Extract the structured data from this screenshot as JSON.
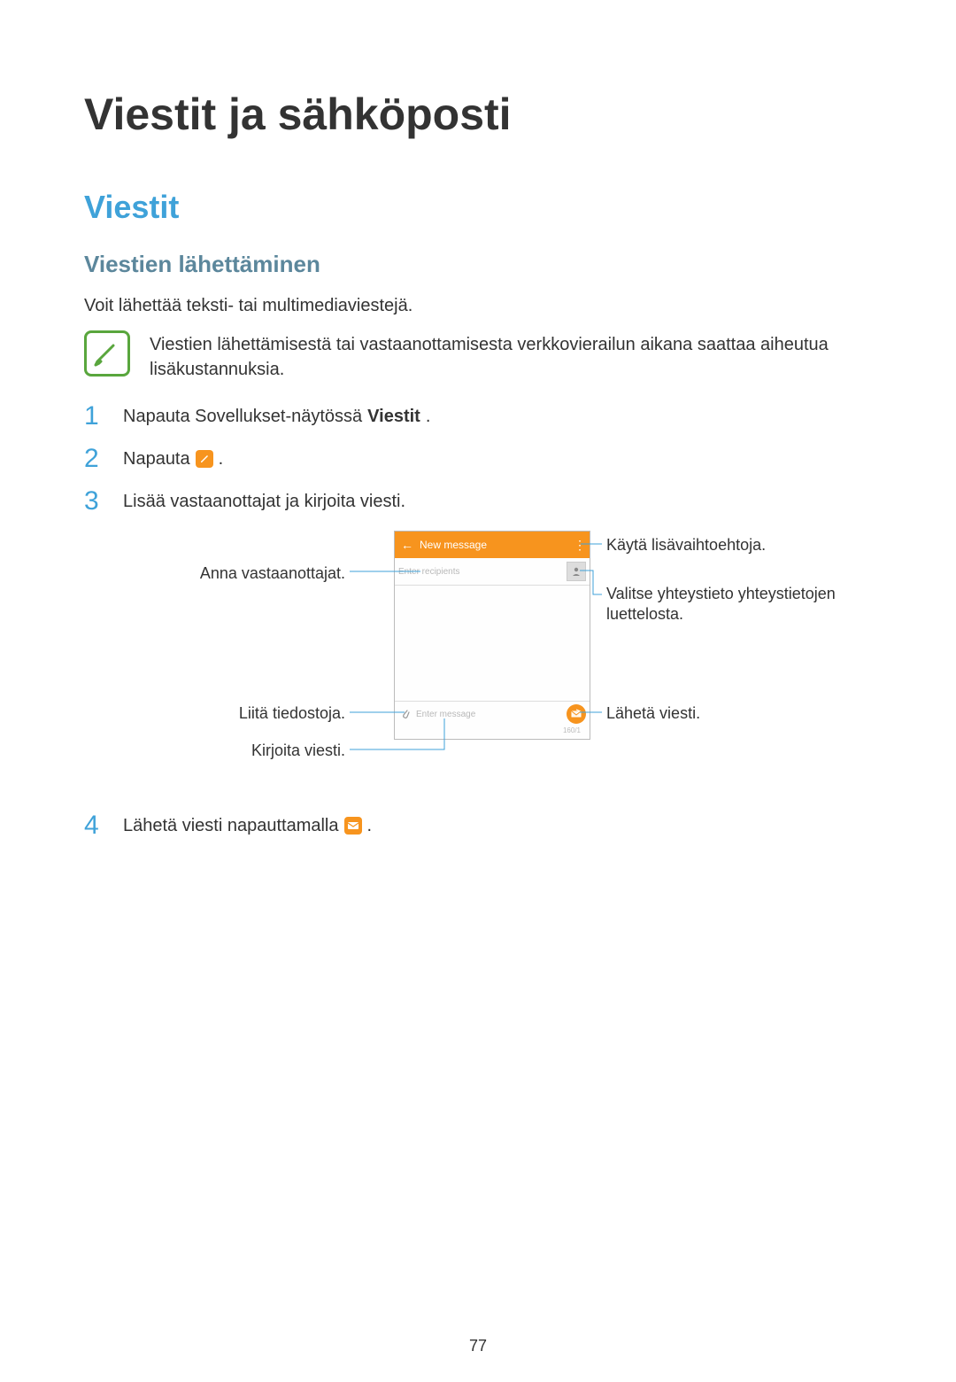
{
  "page_number": "77",
  "h1": "Viestit ja sähköposti",
  "h2": "Viestit",
  "h3": "Viestien lähettäminen",
  "intro": "Voit lähettää teksti- tai multimediaviestejä.",
  "note": "Viestien lähettämisestä tai vastaanottamisesta verkkovierailun aikana saattaa aiheutua lisäkustannuksia.",
  "steps": {
    "s1_pre": "Napauta Sovellukset-näytössä ",
    "s1_bold": "Viestit",
    "s1_post": ".",
    "s2_pre": "Napauta ",
    "s2_post": ".",
    "s3": "Lisää vastaanottajat ja kirjoita viesti.",
    "s4_pre": "Lähetä viesti napauttamalla ",
    "s4_post": "."
  },
  "phone": {
    "header_title": "New message",
    "recipients_placeholder": "Enter recipients",
    "message_placeholder": "Enter message",
    "counter": "160/1"
  },
  "callouts": {
    "more": "Käytä lisävaihtoehtoja.",
    "recipients": "Anna vastaanottajat.",
    "contacts": "Valitse yhteystieto yhteystietojen luettelosta.",
    "attach": "Liitä tiedostoja.",
    "send": "Lähetä viesti.",
    "write": "Kirjoita viesti."
  }
}
